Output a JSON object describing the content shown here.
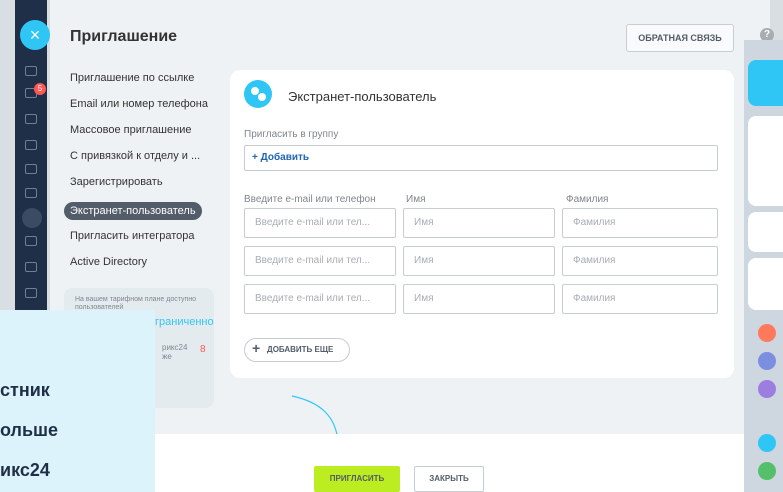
{
  "header": {
    "title": "Приглашение",
    "feedback_label": "ОБРАТНАЯ СВЯЗЬ",
    "help": "?"
  },
  "rail": {
    "close": "×",
    "badge": "5"
  },
  "menu": {
    "items": [
      "Приглашение по ссылке",
      "Email или номер телефона",
      "Массовое приглашение",
      "С привязкой к отделу и ...",
      "Зарегистрировать",
      "Экстранет-пользователь",
      "Пригласить интегратора",
      "Active Directory"
    ],
    "active_index": 5
  },
  "tariff": {
    "line1": "На вашем тарифном плане доступно пользователей",
    "line2": "граниченно",
    "line3": "рикс24",
    "line4": "же",
    "count": "8"
  },
  "card": {
    "title": "Экстранет-пользователь",
    "group_label": "Пригласить в группу",
    "add_label": "+ Добавить",
    "col_email": "Введите e-mail или телефон",
    "col_name": "Имя",
    "col_surname": "Фамилия",
    "rows": [
      {
        "email": "Введите e-mail или тел...",
        "name": "Имя",
        "surname": "Фамилия"
      },
      {
        "email": "Введите e-mail или тел...",
        "name": "Имя",
        "surname": "Фамилия"
      },
      {
        "email": "Введите e-mail или тел...",
        "name": "Имя",
        "surname": "Фамилия"
      }
    ],
    "add_more": "ДОБАВИТЬ ЕЩЕ"
  },
  "footer": {
    "invite": "ПРИГЛАСИТЬ",
    "close": "ЗАКРЫТЬ"
  },
  "overlay": {
    "line1": "стник",
    "line2": "ольше",
    "line3": "икс24"
  },
  "colors": {
    "accent": "#2fc6f6",
    "invite": "#bbed21",
    "dark": "#1f2f47"
  }
}
